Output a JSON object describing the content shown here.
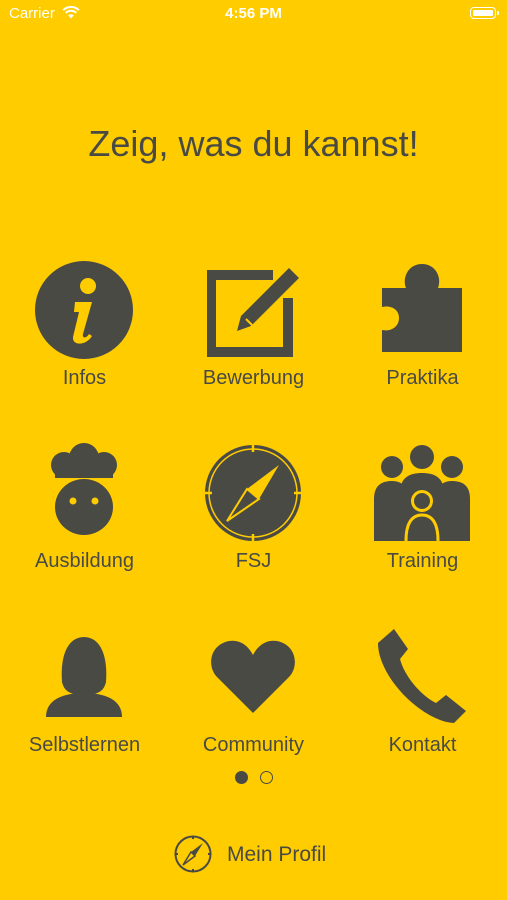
{
  "status_bar": {
    "carrier": "Carrier",
    "time": "4:56 PM"
  },
  "headline": "Zeig, was du kannst!",
  "tiles": [
    {
      "label": "Infos",
      "icon": "info-icon"
    },
    {
      "label": "Bewerbung",
      "icon": "edit-icon"
    },
    {
      "label": "Praktika",
      "icon": "puzzle-icon"
    },
    {
      "label": "Ausbildung",
      "icon": "chef-icon"
    },
    {
      "label": "FSJ",
      "icon": "compass-icon"
    },
    {
      "label": "Training",
      "icon": "group-icon"
    },
    {
      "label": "Selbstlernen",
      "icon": "person-icon"
    },
    {
      "label": "Community",
      "icon": "heart-icon"
    },
    {
      "label": "Kontakt",
      "icon": "phone-icon"
    }
  ],
  "pager": {
    "pages": 2,
    "active": 1
  },
  "profile": {
    "label": "Mein Profil",
    "icon": "compass-icon"
  },
  "colors": {
    "background": "#FFCC00",
    "icon": "#4a4a45",
    "status_text": "#FFFFFF"
  }
}
